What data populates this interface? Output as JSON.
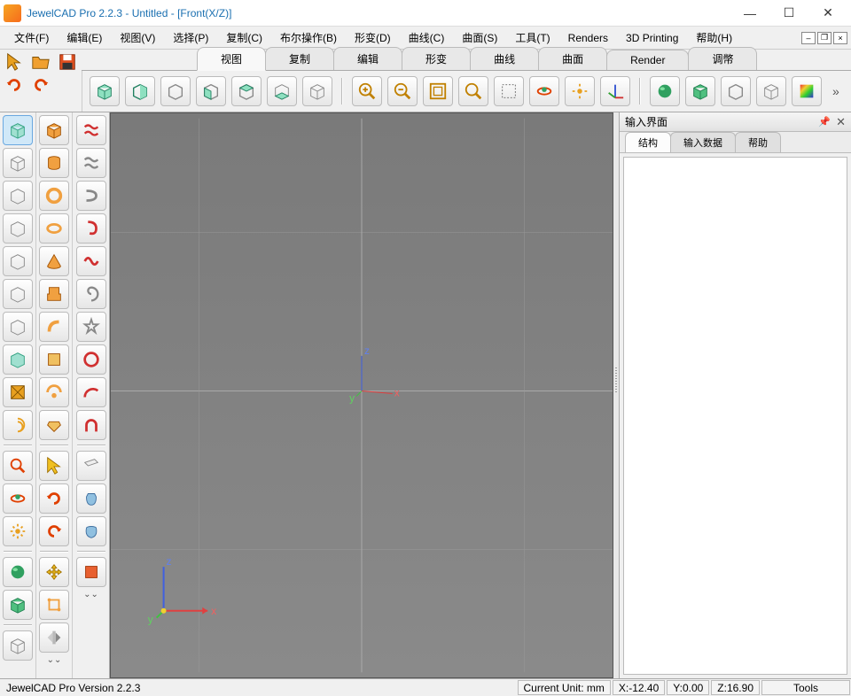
{
  "window": {
    "title": "JewelCAD Pro 2.2.3 - Untitled - [Front(X/Z)]"
  },
  "menu": [
    "文件(F)",
    "编辑(E)",
    "视图(V)",
    "选择(P)",
    "复制(C)",
    "布尔操作(B)",
    "形变(D)",
    "曲线(C)",
    "曲面(S)",
    "工具(T)",
    "Renders",
    "3D Printing",
    "帮助(H)"
  ],
  "tabs": [
    "视图",
    "复制",
    "编辑",
    "形变",
    "曲线",
    "曲面",
    "Render",
    "调幣"
  ],
  "tabs_active": 0,
  "right_panel": {
    "title": "输入界面",
    "tabs": [
      "结构",
      "输入数据",
      "帮助"
    ],
    "active": 0
  },
  "status": {
    "version": "JewelCAD Pro Version 2.2.3",
    "unit_label": "Current Unit:",
    "unit": "mm",
    "x": "X:-12.40",
    "y": "Y:0.00",
    "z": "Z:16.90",
    "tools": "Tools"
  },
  "axes": {
    "x": "x",
    "y": "y",
    "z": "z"
  }
}
